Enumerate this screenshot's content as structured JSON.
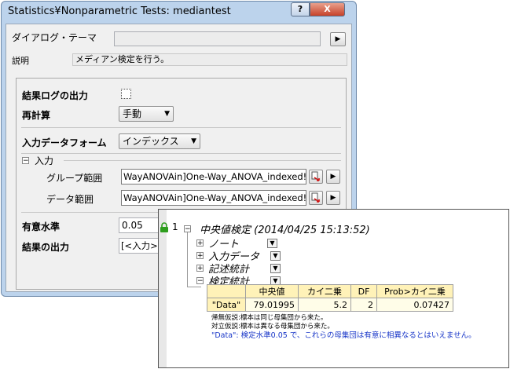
{
  "dialog": {
    "title": "Statistics¥Nonparametric Tests: mediantest",
    "help_label": "?",
    "close_label": "X",
    "theme_label": "ダイアログ・テーマ",
    "theme_value": "",
    "theme_button": "▶",
    "description_label": "説明",
    "description_value": "メディアン検定を行う。",
    "log_output_label": "結果ログの出力",
    "recalc_label": "再計算",
    "recalc_value": "手動",
    "input_form_label": "入力データフォーム",
    "input_form_value": "インデックス",
    "input_section_label": "入力",
    "input_section_toggle": "−",
    "group_range_label": "グループ範囲",
    "group_range_value": "WayANOVAin]One-Way_ANOVA_indexed!B",
    "data_range_label": "データ範囲",
    "data_range_value": "WayANOVAin]One-Way_ANOVA_indexed!C",
    "range_menu_button": "▶",
    "significance_label": "有意水準",
    "significance_value": "0.05",
    "result_output_label": "結果の出力",
    "result_output_value": "[<入力>]<"
  },
  "report": {
    "row_number": "1",
    "title": "中央値検定 (2014/04/25 15:13:52)",
    "nodes": [
      {
        "label": "ノート",
        "toggle": "+"
      },
      {
        "label": "入力データ",
        "toggle": "+"
      },
      {
        "label": "記述統計",
        "toggle": "+"
      },
      {
        "label": "検定統計",
        "toggle": "−"
      }
    ],
    "table": {
      "headers": [
        "",
        "中央値",
        "カイ二乗",
        "DF",
        "Prob>カイ二乗"
      ],
      "rows": [
        {
          "name": "\"Data\"",
          "median": "79.01995",
          "chisq": "5.2",
          "df": "2",
          "prob": "0.07427"
        }
      ]
    },
    "null_hypothesis": "帰無仮説:標本は同じ母集団から来た。",
    "alt_hypothesis": "対立仮説:標本は異なる母集団から来た。",
    "conclusion": "\"Data\": 検定水準0.05 で、これらの母集団は有意に相異なるとはいえません。"
  },
  "colors": {
    "window_frame": "#bcd3ec",
    "table_header": "#fff2b8",
    "conclusion_text": "#1836c8",
    "lock_icon": "#2e9e1e"
  }
}
